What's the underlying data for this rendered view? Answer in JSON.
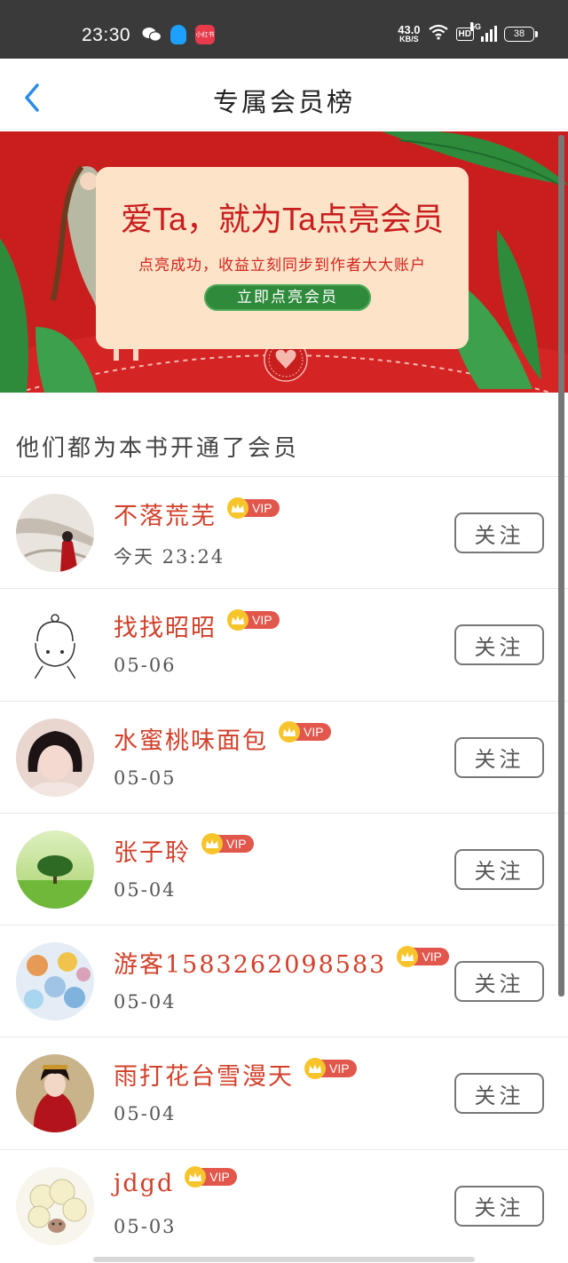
{
  "status_bar": {
    "time": "23:30",
    "net_speed_value": "43.0",
    "net_speed_unit": "KB/S",
    "hd_label": "HD",
    "signal_label": "5G",
    "battery": "38",
    "icons": [
      "wechat-icon",
      "qq-icon",
      "xiaohongshu-icon",
      "wifi-icon",
      "signal-icon",
      "battery-icon"
    ]
  },
  "header": {
    "back_icon": "chevron-left-icon",
    "title": "专属会员榜"
  },
  "banner": {
    "title": "爱Ta，就为Ta点亮会员",
    "subtitle": "点亮成功，收益立刻同步到作者大大账户",
    "button_label": "立即点亮会员",
    "colors": {
      "background": "#c81e1e",
      "card": "#fde3c8",
      "button": "#2f8a3c"
    }
  },
  "section": {
    "title": "他们都为本书开通了会员"
  },
  "members": [
    {
      "name": "不落荒芜",
      "vip": "VIP",
      "date": "今天 23:24",
      "follow": "关注",
      "avatar": "avatar-red-dress-snow"
    },
    {
      "name": "找找昭昭",
      "vip": "VIP",
      "date": "05-06",
      "follow": "关注",
      "avatar": "avatar-sketch-girl"
    },
    {
      "name": "水蜜桃味面包",
      "vip": "VIP",
      "date": "05-05",
      "follow": "关注",
      "avatar": "avatar-girl-photo"
    },
    {
      "name": "张子聆",
      "vip": "VIP",
      "date": "05-04",
      "follow": "关注",
      "avatar": "avatar-tree-field"
    },
    {
      "name": "游客15832620985​83",
      "vip": "VIP",
      "date": "05-04",
      "follow": "关注",
      "avatar": "avatar-cartoon-bears"
    },
    {
      "name": "雨打花台雪漫天",
      "vip": "VIP",
      "date": "05-04",
      "follow": "关注",
      "avatar": "avatar-red-costume"
    },
    {
      "name": "jdgd",
      "vip": "VIP",
      "date": "05-03",
      "follow": "关注",
      "avatar": "avatar-sheep-doodle"
    }
  ],
  "colors": {
    "name_red": "#d2402a",
    "vip_badge": "#e2574c",
    "crown": "#f7c52b",
    "back_blue": "#2a8ce6"
  }
}
